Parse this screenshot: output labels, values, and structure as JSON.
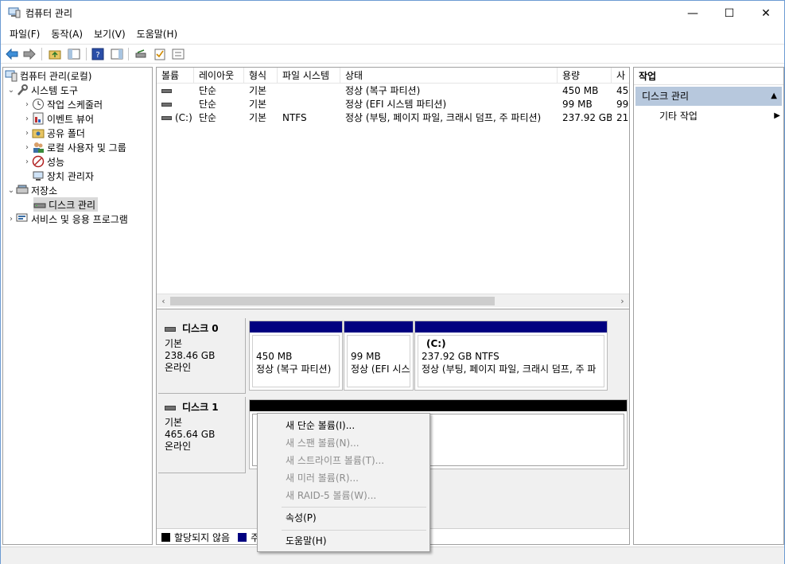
{
  "window": {
    "title": "컴퓨터 관리",
    "minimize": "—",
    "maximize": "☐",
    "close": "✕"
  },
  "menu": [
    "파일(F)",
    "동작(A)",
    "보기(V)",
    "도움말(H)"
  ],
  "toolbar_icons": [
    "back-icon",
    "forward-icon",
    "up-folder-icon",
    "show-hide-tree-icon",
    "help-icon",
    "show-hide-action-pane-icon",
    "disk-connect-icon",
    "checklist-icon",
    "properties-icon"
  ],
  "tree": [
    {
      "label": "컴퓨터 관리(로컬)",
      "icon": "computer-management-icon",
      "expander": ""
    },
    {
      "label": "시스템 도구",
      "icon": "system-tools-icon",
      "expander": "⌄"
    },
    {
      "label": "작업 스케줄러",
      "icon": "clock-icon",
      "expander": "›"
    },
    {
      "label": "이벤트 뷰어",
      "icon": "event-viewer-icon",
      "expander": "›"
    },
    {
      "label": "공유 폴더",
      "icon": "shared-folder-icon",
      "expander": "›"
    },
    {
      "label": "로컬 사용자 및 그룹",
      "icon": "users-icon",
      "expander": "›"
    },
    {
      "label": "성능",
      "icon": "performance-icon",
      "expander": "›"
    },
    {
      "label": "장치 관리자",
      "icon": "device-manager-icon",
      "expander": ""
    },
    {
      "label": "저장소",
      "icon": "storage-icon",
      "expander": "⌄"
    },
    {
      "label": "디스크 관리",
      "icon": "disk-management-icon",
      "expander": ""
    },
    {
      "label": "서비스 및 응용 프로그램",
      "icon": "services-icon",
      "expander": "›"
    }
  ],
  "volume_table": {
    "columns": [
      "볼륨",
      "레이아웃",
      "형식",
      "파일 시스템",
      "상태",
      "용량",
      "사"
    ],
    "rows": [
      {
        "volume": "",
        "layout": "단순",
        "type": "기본",
        "fs": "",
        "status": "정상 (복구 파티션)",
        "capacity": "450 MB",
        "free": "45"
      },
      {
        "volume": "",
        "layout": "단순",
        "type": "기본",
        "fs": "",
        "status": "정상 (EFI 시스템 파티션)",
        "capacity": "99 MB",
        "free": "99"
      },
      {
        "volume": "(C:)",
        "layout": "단순",
        "type": "기본",
        "fs": "NTFS",
        "status": "정상 (부팅, 페이지 파일, 크래시 덤프, 주 파티션)",
        "capacity": "237.92 GB",
        "free": "21"
      }
    ]
  },
  "disks": [
    {
      "name": "디스크 0",
      "type": "기본",
      "size": "238.46 GB",
      "state": "온라인",
      "partitions": [
        {
          "line1": "",
          "line2": "450 MB",
          "line3": "정상 (복구 파티션)"
        },
        {
          "line1": "",
          "line2": "99 MB",
          "line3": "정상 (EFI 시스"
        },
        {
          "line1": "(C:)",
          "line2": "237.92 GB NTFS",
          "line3": "정상 (부팅, 페이지 파일, 크래시 덤프, 주 파"
        }
      ]
    },
    {
      "name": "디스크 1",
      "type": "기본",
      "size": "465.64 GB",
      "state": "온라인",
      "partitions": []
    }
  ],
  "legend": [
    {
      "label": "할당되지 않음",
      "color": "#000000"
    },
    {
      "label": "주",
      "color": "#000080"
    }
  ],
  "actions": {
    "header": "작업",
    "section": "디스크 관리",
    "section_arrow": "▲",
    "item": "기타 작업",
    "item_arrow": "▶"
  },
  "context_menu": [
    {
      "label": "새 단순 볼륨(I)...",
      "enabled": true
    },
    {
      "label": "새 스팬 볼륨(N)...",
      "enabled": false
    },
    {
      "label": "새 스트라이프 볼륨(T)...",
      "enabled": false
    },
    {
      "label": "새 미러 볼륨(R)...",
      "enabled": false
    },
    {
      "label": "새 RAID-5 볼륨(W)...",
      "enabled": false
    },
    {
      "label": "속성(P)",
      "enabled": true
    },
    {
      "label": "도움말(H)",
      "enabled": true
    }
  ],
  "colors": {
    "primary_partition": "#000080",
    "unallocated": "#000000",
    "action_section_bg": "#b7c8dd"
  }
}
